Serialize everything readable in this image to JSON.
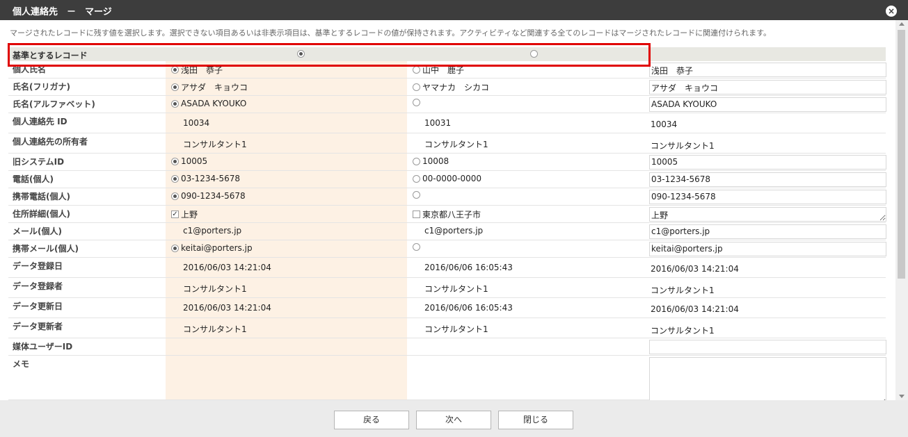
{
  "dialog": {
    "title": "個人連絡先　－　マージ",
    "close_label": "×"
  },
  "description": "マージされたレコードに残す値を選択します。選択できない項目あるいは非表示項目は、基準とするレコードの値が保持されます。アクティビティなど関連する全てのレコードはマージされたレコードに関連付けられます。",
  "base_record": {
    "label": "基準とするレコード",
    "selected": "a"
  },
  "rows": [
    {
      "label": "個人氏名",
      "ctl": "radio",
      "sel": "a",
      "a": "浅田　恭子",
      "b": "山中　鹿子",
      "result": "浅田　恭子",
      "rtype": "input"
    },
    {
      "label": "氏名(フリガナ)",
      "ctl": "radio",
      "sel": "a",
      "a": "アサダ　キョウコ",
      "b": "ヤマナカ　シカコ",
      "result": "アサダ　キョウコ",
      "rtype": "input"
    },
    {
      "label": "氏名(アルファベット)",
      "ctl": "radio",
      "sel": "a",
      "a": "ASADA KYOUKO",
      "b": "",
      "result": "ASADA KYOUKO",
      "rtype": "input"
    },
    {
      "label": "個人連絡先 ID",
      "ctl": "none",
      "a": "10034",
      "b": "10031",
      "result": "10034",
      "rtype": "text"
    },
    {
      "label": "個人連絡先の所有者",
      "ctl": "none",
      "a": "コンサルタント1",
      "b": "コンサルタント1",
      "result": "コンサルタント1",
      "rtype": "text"
    },
    {
      "label": "旧システムID",
      "ctl": "radio",
      "sel": "a",
      "a": "10005",
      "b": "10008",
      "result": "10005",
      "rtype": "input"
    },
    {
      "label": "電話(個人)",
      "ctl": "radio",
      "sel": "a",
      "a": "03-1234-5678",
      "b": "00-0000-0000",
      "result": "03-1234-5678",
      "rtype": "input"
    },
    {
      "label": "携帯電話(個人)",
      "ctl": "radio",
      "sel": "a",
      "a": "090-1234-5678",
      "b": "",
      "result": "090-1234-5678",
      "rtype": "input"
    },
    {
      "label": "住所詳細(個人)",
      "ctl": "check",
      "sel": "a",
      "a": "上野",
      "b": "東京都八王子市",
      "result": "上野",
      "rtype": "textarea"
    },
    {
      "label": "メール(個人)",
      "ctl": "none",
      "a": "c1@porters.jp",
      "b": "c1@porters.jp",
      "result": "c1@porters.jp",
      "rtype": "input"
    },
    {
      "label": "携帯メール(個人)",
      "ctl": "radio",
      "sel": "a",
      "a": "keitai@porters.jp",
      "b": "",
      "result": "keitai@porters.jp",
      "rtype": "input"
    },
    {
      "label": "データ登録日",
      "ctl": "none",
      "a": "2016/06/03 14:21:04",
      "b": "2016/06/06 16:05:43",
      "result": "2016/06/03 14:21:04",
      "rtype": "text"
    },
    {
      "label": "データ登録者",
      "ctl": "none",
      "a": "コンサルタント1",
      "b": "コンサルタント1",
      "result": "コンサルタント1",
      "rtype": "text"
    },
    {
      "label": "データ更新日",
      "ctl": "none",
      "a": "2016/06/03 14:21:04",
      "b": "2016/06/06 16:05:43",
      "result": "2016/06/03 14:21:04",
      "rtype": "text"
    },
    {
      "label": "データ更新者",
      "ctl": "none",
      "a": "コンサルタント1",
      "b": "コンサルタント1",
      "result": "コンサルタント1",
      "rtype": "text"
    },
    {
      "label": "媒体ユーザーID",
      "ctl": "none",
      "a": "",
      "b": "",
      "result": "",
      "rtype": "input"
    },
    {
      "label": "メモ",
      "ctl": "none",
      "a": "",
      "b": "",
      "result": "",
      "rtype": "memo"
    }
  ],
  "footer": {
    "back": "戻る",
    "next": "次へ",
    "close": "閉じる"
  }
}
